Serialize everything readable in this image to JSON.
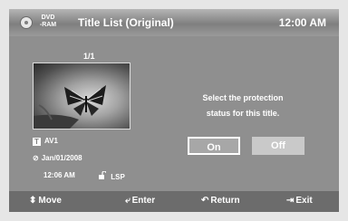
{
  "header": {
    "disc_line1": "DVD",
    "disc_line2": "-RAM",
    "title": "Title List (Original)",
    "clock": "12:00 AM"
  },
  "preview": {
    "counter": "1/1"
  },
  "info": {
    "title_name": "AV1",
    "date": "Jan/01/2008",
    "time": "12:06 AM",
    "record_mode": "LSP"
  },
  "dialog": {
    "message_line1": "Select the protection",
    "message_line2": "status for this title.",
    "on_label": "On",
    "off_label": "Off",
    "selected": "On"
  },
  "footer": {
    "move": "Move",
    "enter": "Enter",
    "return": "Return",
    "exit": "Exit"
  },
  "icons": {
    "disc": "disc-icon",
    "title": "title-t-icon",
    "clock": "clock-icon",
    "lock": "unlock-icon",
    "move": "updown-arrow-icon",
    "enter": "enter-icon",
    "return": "return-icon",
    "exit": "exit-icon"
  }
}
